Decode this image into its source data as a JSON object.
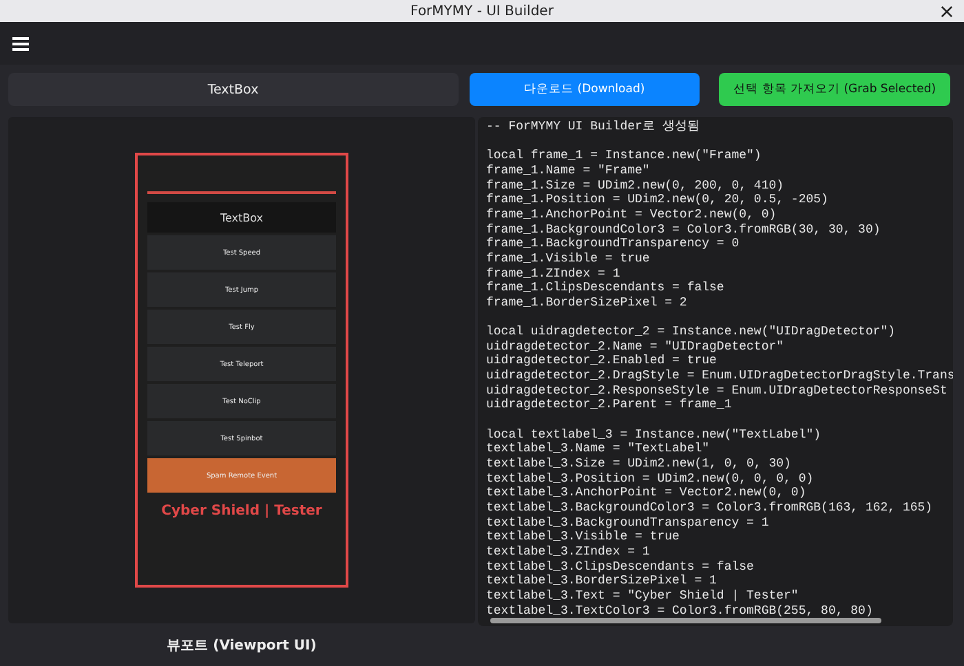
{
  "window": {
    "title": "ForMYMY - UI Builder"
  },
  "toolbar": {
    "name_field": {
      "value": "TextBox"
    },
    "buttons": [
      {
        "label": "다운로드 (Download)",
        "kind": "primary"
      },
      {
        "label": "선택 항목 가져오기 (Grab Selected)",
        "kind": "success"
      }
    ]
  },
  "preview": {
    "items": [
      {
        "label": "TextBox",
        "kind": "textbox"
      },
      {
        "label": "Test Speed",
        "kind": "button"
      },
      {
        "label": "Test Jump",
        "kind": "button"
      },
      {
        "label": "Test Fly",
        "kind": "button"
      },
      {
        "label": "Test Teleport",
        "kind": "button"
      },
      {
        "label": "Test NoClip",
        "kind": "button"
      },
      {
        "label": "Test Spinbot",
        "kind": "button"
      },
      {
        "label": "Spam Remote Event",
        "kind": "accent"
      },
      {
        "label": "Cyber Shield | Tester",
        "kind": "label"
      }
    ],
    "caption": "뷰포트 (Viewport UI)"
  },
  "code": {
    "blocks": [
      {
        "lines": [
          "-- ForMYMY UI Builder로 생성됨"
        ]
      },
      {
        "lines": [
          "local frame_1 = Instance.new(\"Frame\")",
          "frame_1.Name = \"Frame\"",
          "frame_1.Size = UDim2.new(0, 200, 0, 410)",
          "frame_1.Position = UDim2.new(0, 20, 0.5, -205)",
          "frame_1.AnchorPoint = Vector2.new(0, 0)",
          "frame_1.BackgroundColor3 = Color3.fromRGB(30, 30, 30)",
          "frame_1.BackgroundTransparency = 0",
          "frame_1.Visible = true",
          "frame_1.ZIndex = 1",
          "frame_1.ClipsDescendants = false",
          "frame_1.BorderSizePixel = 2"
        ]
      },
      {
        "lines": [
          "local uidragdetector_2 = Instance.new(\"UIDragDetector\")",
          "uidragdetector_2.Name = \"UIDragDetector\"",
          "uidragdetector_2.Enabled = true",
          "uidragdetector_2.DragStyle = Enum.UIDragDetectorDragStyle.Trans",
          "uidragdetector_2.ResponseStyle = Enum.UIDragDetectorResponseSt",
          "uidragdetector_2.Parent = frame_1"
        ]
      },
      {
        "lines": [
          "local textlabel_3 = Instance.new(\"TextLabel\")",
          "textlabel_3.Name = \"TextLabel\"",
          "textlabel_3.Size = UDim2.new(1, 0, 0, 30)",
          "textlabel_3.Position = UDim2.new(0, 0, 0, 0)",
          "textlabel_3.AnchorPoint = Vector2.new(0, 0)",
          "textlabel_3.BackgroundColor3 = Color3.fromRGB(163, 162, 165)",
          "textlabel_3.BackgroundTransparency = 1",
          "textlabel_3.Visible = true",
          "textlabel_3.ZIndex = 1",
          "textlabel_3.ClipsDescendants = false",
          "textlabel_3.BorderSizePixel = 1",
          "textlabel_3.Text = \"Cyber Shield | Tester\"",
          "textlabel_3.TextColor3 = Color3.fromRGB(255, 80, 80)"
        ]
      }
    ]
  }
}
